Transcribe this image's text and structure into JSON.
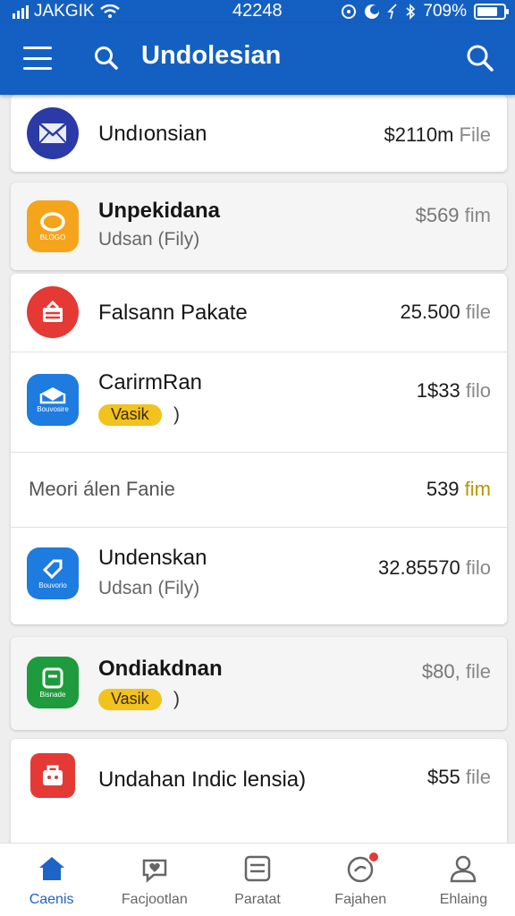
{
  "status_bar": {
    "carrier": "JAKGIK",
    "time": "42248",
    "battery": "709%",
    "icons": [
      "signal-icon",
      "wifi-icon",
      "alarm-icon",
      "moon-icon",
      "location-icon",
      "bluetooth-icon",
      "battery-icon"
    ]
  },
  "app_bar": {
    "title": "Undolesian",
    "icons": [
      "menu-icon",
      "search-icon",
      "search-icon"
    ]
  },
  "items": [
    {
      "title": "Undıonsian",
      "price": "$2110m",
      "unit": "File",
      "icon": "mail-icon",
      "color": "#2b3aa6"
    },
    {
      "title": "Unpekidana",
      "subtitle": "Udsan (Fily)",
      "price": "$569",
      "unit": "fim",
      "icon": "circle-icon",
      "icon_caption": "BLOGO",
      "color": "#f5a51b"
    },
    {
      "title": "Falsann Pakate",
      "price": "25.500",
      "unit": "file",
      "icon": "package-icon",
      "color": "#e53935"
    },
    {
      "title": "CarirmRan",
      "badge": "Vasik",
      "badge_suffix": ")",
      "price": "1$33",
      "unit": "filo",
      "icon": "envelope-icon",
      "icon_caption": "Bouvosire",
      "color": "#1e7be0"
    },
    {
      "title": "Meori álen Fanie",
      "price": "539",
      "unit": "fim",
      "unit_accent": "#b89500"
    },
    {
      "title": "Undenskan",
      "subtitle": "Udsan (Fily)",
      "price": "32.85570",
      "unit": "filo",
      "icon": "tag-icon",
      "icon_caption": "Bouvorio",
      "color": "#1e7be0"
    },
    {
      "title": "Ondiakdnan",
      "badge": "Vasik",
      "badge_suffix": ")",
      "price": "$80,",
      "unit": "file",
      "icon": "document-icon",
      "icon_caption": "Bisnade",
      "color": "#1e9b3c"
    },
    {
      "title": "Undahan Indic lensia)",
      "price": "$55",
      "unit": "file",
      "icon": "bag-icon",
      "color": "#e53935"
    }
  ],
  "bottom_nav": [
    {
      "label": "Caenis",
      "icon": "home-icon",
      "active": true
    },
    {
      "label": "Facjootlan",
      "icon": "heart-chat-icon"
    },
    {
      "label": "Paratat",
      "icon": "list-icon"
    },
    {
      "label": "Fajahen",
      "icon": "bell-icon",
      "badge": true
    },
    {
      "label": "Ehlaing",
      "icon": "person-icon"
    }
  ],
  "colors": {
    "primary": "#1460c2",
    "badge": "#f2c21e",
    "active_nav": "#1e63c8"
  }
}
